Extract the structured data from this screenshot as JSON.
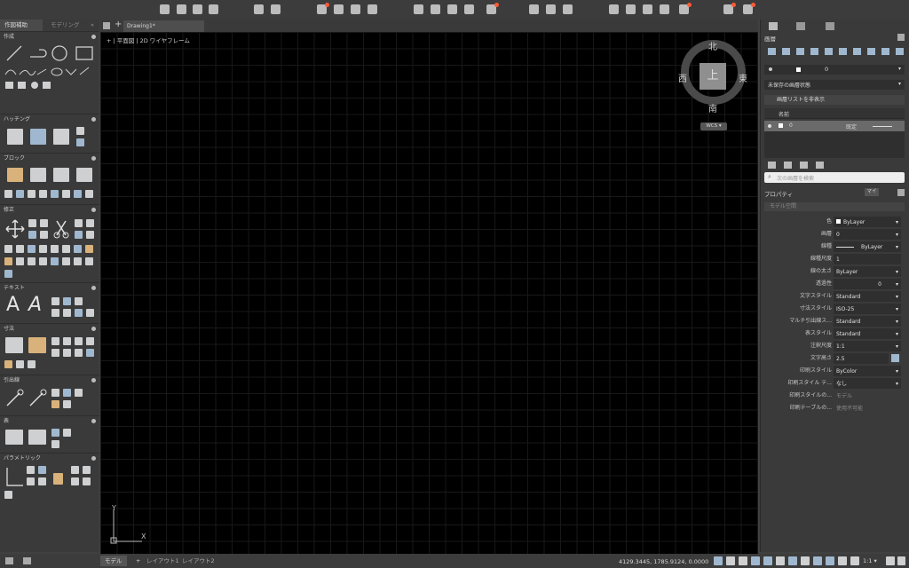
{
  "left_panel": {
    "tabs": [
      "作図補助",
      "モデリング"
    ],
    "collapse": "»",
    "sections": [
      {
        "label": "作成"
      },
      {
        "label": "ハッチング"
      },
      {
        "label": "ブロック"
      },
      {
        "label": "修正"
      },
      {
        "label": "テキスト"
      },
      {
        "label": "寸法"
      },
      {
        "label": "引出線"
      },
      {
        "label": "表"
      },
      {
        "label": "パラメトリック"
      }
    ]
  },
  "doc_tab": {
    "title": "Drawing1*",
    "plus": "+"
  },
  "viewport_label": "+  |  平面図  |  2D ワイヤフレーム",
  "viewcube": {
    "top": "上",
    "north": "北",
    "south": "南",
    "east": "東",
    "west": "西",
    "wcs": "WCS ▾"
  },
  "ucs": {
    "x": "X",
    "y": "Y"
  },
  "right_panel": {
    "title_layers": "画層",
    "current_layer": "0",
    "layer_state": "未保存の画層状態",
    "hide_list": "画層リストを非表示",
    "col_name": "名前",
    "layer_row_name": "0",
    "layer_row_linetype": "既定",
    "search_placeholder": "次の画層を検索",
    "properties_title": "プロパティ",
    "properties_badge": "マイ",
    "model_space": "モデル空間",
    "props": [
      {
        "label": "色",
        "value": "ByLayer"
      },
      {
        "label": "画層",
        "value": "0"
      },
      {
        "label": "線種",
        "value": "ByLayer"
      },
      {
        "label": "線種尺度",
        "value": "1"
      },
      {
        "label": "線の太さ",
        "value": "ByLayer"
      },
      {
        "label": "透過性",
        "value": "0"
      },
      {
        "label": "文字スタイル",
        "value": "Standard"
      },
      {
        "label": "寸法スタイル",
        "value": "ISO-25"
      },
      {
        "label": "マルチ引出線ス...",
        "value": "Standard"
      },
      {
        "label": "表スタイル",
        "value": "Standard"
      },
      {
        "label": "注釈尺度",
        "value": "1:1"
      },
      {
        "label": "文字高さ",
        "value": "2.5"
      },
      {
        "label": "印刷スタイル",
        "value": "ByColor"
      },
      {
        "label": "印刷スタイル テ...",
        "value": "なし"
      },
      {
        "label": "印刷スタイルの...",
        "value": "モデル"
      },
      {
        "label": "印刷テーブルの...",
        "value": "使用不可能"
      }
    ]
  },
  "status": {
    "tab_model": "モデル",
    "plus": "+",
    "layout1": "レイアウト1",
    "layout2": "レイアウト2",
    "coords": "4129.3445, 1785.9124, 0.0000",
    "scale": "1:1 ▾"
  }
}
